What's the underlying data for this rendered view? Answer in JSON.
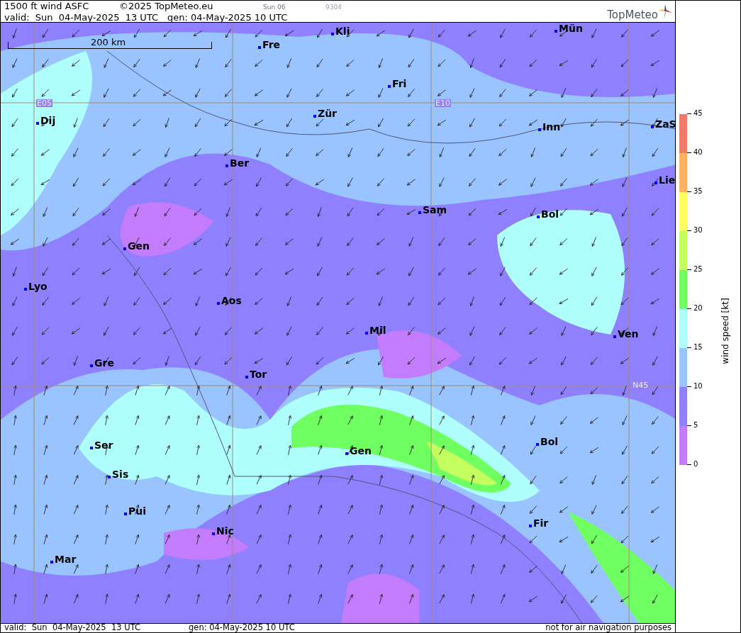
{
  "header": {
    "title": "1500 ft wind ASFC",
    "copyright": "©2025 TopMeteo.eu",
    "day_code": "Sun 06",
    "run_code": "9304",
    "valid": "valid:  Sun  04-May-2025  13 UTC",
    "generated": "gen: 04-May-2025 10 UTC",
    "logo": "TopMeteo"
  },
  "map": {
    "scale": "200 km",
    "grid_labels": [
      "E05",
      "E10",
      "N45"
    ],
    "cities": [
      "Kli",
      "Mün",
      "Fre",
      "Fri",
      "Dij",
      "Zür",
      "Inn",
      "ZaS",
      "Ber",
      "Lie",
      "Sam",
      "Bol",
      "Gen",
      "Lyo",
      "Aos",
      "Mil",
      "Ven",
      "Gre",
      "Tor",
      "Ser",
      "Gen",
      "Bol",
      "Sis",
      "Pui",
      "Nic",
      "Fir",
      "Mar"
    ]
  },
  "legend": {
    "title": "wind speed [kt]",
    "bands": [
      {
        "color": "#f07a68"
      },
      {
        "color": "#ffb060"
      },
      {
        "color": "#ffff60"
      },
      {
        "color": "#c4ff60"
      },
      {
        "color": "#70ff60"
      },
      {
        "color": "#b0ffff"
      },
      {
        "color": "#99c4ff"
      },
      {
        "color": "#9080ff"
      },
      {
        "color": "#c47cff"
      }
    ],
    "ticks": [
      "45",
      "40",
      "35",
      "30",
      "25",
      "20",
      "15",
      "10",
      "5",
      "0"
    ]
  },
  "footer": {
    "valid": "valid:  Sun  04-May-2025  13 UTC",
    "generated": "gen: 04-May-2025 10 UTC",
    "disclaimer": "not for air navigation purposes"
  }
}
